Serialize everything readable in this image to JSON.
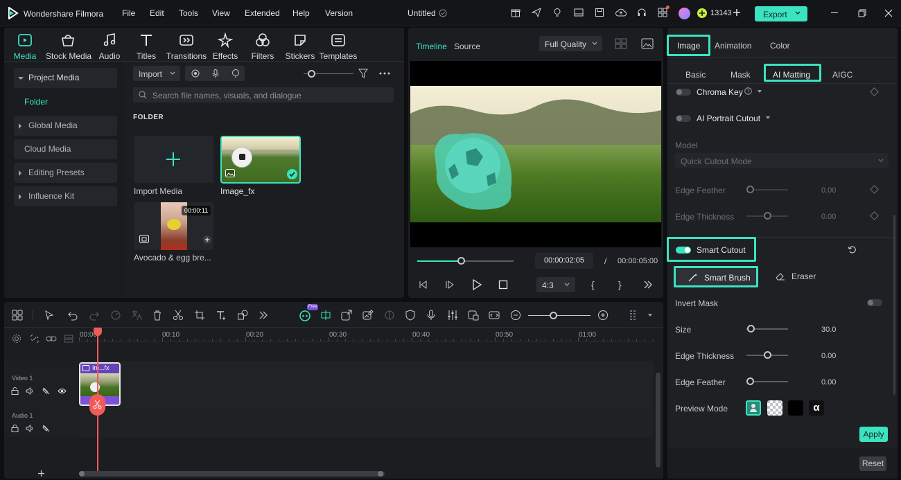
{
  "app": {
    "title": "Wondershare Filmora",
    "menu": [
      "File",
      "Edit",
      "Tools",
      "View",
      "Extended",
      "Help",
      "Version"
    ],
    "project_title": "Untitled",
    "credits": "13143",
    "export_label": "Export"
  },
  "toolbar": {
    "items": [
      {
        "label": "Media",
        "icon": "media-icon"
      },
      {
        "label": "Stock Media",
        "icon": "stock-media-icon"
      },
      {
        "label": "Audio",
        "icon": "audio-icon"
      },
      {
        "label": "Titles",
        "icon": "titles-icon"
      },
      {
        "label": "Transitions",
        "icon": "transitions-icon"
      },
      {
        "label": "Effects",
        "icon": "effects-icon"
      },
      {
        "label": "Filters",
        "icon": "filters-icon"
      },
      {
        "label": "Stickers",
        "icon": "stickers-icon"
      },
      {
        "label": "Templates",
        "icon": "templates-icon"
      }
    ]
  },
  "sidebar": {
    "items": [
      {
        "label": "Project Media"
      },
      {
        "label": "Folder"
      },
      {
        "label": "Global Media"
      },
      {
        "label": "Cloud Media"
      },
      {
        "label": "Editing Presets"
      },
      {
        "label": "Influence Kit"
      }
    ]
  },
  "media": {
    "import_label": "Import",
    "search_placeholder": "Search file names, visuals, and dialogue",
    "folder_heading": "FOLDER",
    "items": [
      {
        "label": "Import Media"
      },
      {
        "label": "Image_fx"
      },
      {
        "label": "Avocado & egg bre...",
        "duration": "00:00:11"
      }
    ]
  },
  "player": {
    "tabs": [
      "Timeline",
      "Source"
    ],
    "quality": "Full Quality",
    "current_time": "00:00:02:05",
    "separator": "/",
    "total_time": "00:00:05:00",
    "aspect": "4:3",
    "progress": 0.45
  },
  "timeline": {
    "ruler": [
      "00:00",
      "00:10",
      "00:20",
      "00:30",
      "00:40",
      "00:50",
      "01:00"
    ],
    "tracks": [
      {
        "label": "Video 1"
      },
      {
        "label": "Audio 1"
      }
    ],
    "clip_label": "Im...fx",
    "free_badge": "Free"
  },
  "properties": {
    "tabs": [
      "Image",
      "Animation",
      "Color"
    ],
    "subtabs": [
      "Basic",
      "Mask",
      "AI Matting",
      "AIGC"
    ],
    "chroma_key": "Chroma Key",
    "ai_portrait": "AI Portrait Cutout",
    "model_label": "Model",
    "model_value": "Quick Cutout Mode",
    "edge_feather_label": "Edge Feather",
    "edge_feather_value": "0.00",
    "edge_thickness_label": "Edge Thickness",
    "edge_thickness_value": "0.00",
    "smart_cutout": "Smart Cutout",
    "smart_brush": "Smart Brush",
    "eraser": "Eraser",
    "invert_mask": "Invert Mask",
    "size_label": "Size",
    "size_value": "30.0",
    "size_fraction": 0.1,
    "edge_thickness2_label": "Edge Thickness",
    "edge_thickness2_value": "0.00",
    "edge_feather2_label": "Edge Feather",
    "edge_feather2_value": "0.00",
    "preview_mode": "Preview Mode",
    "alpha_symbol": "α",
    "apply": "Apply",
    "reset": "Reset"
  },
  "colors": {
    "accent": "#3be3c1",
    "playhead": "#f25a5a",
    "clip": "#7b52d6"
  }
}
